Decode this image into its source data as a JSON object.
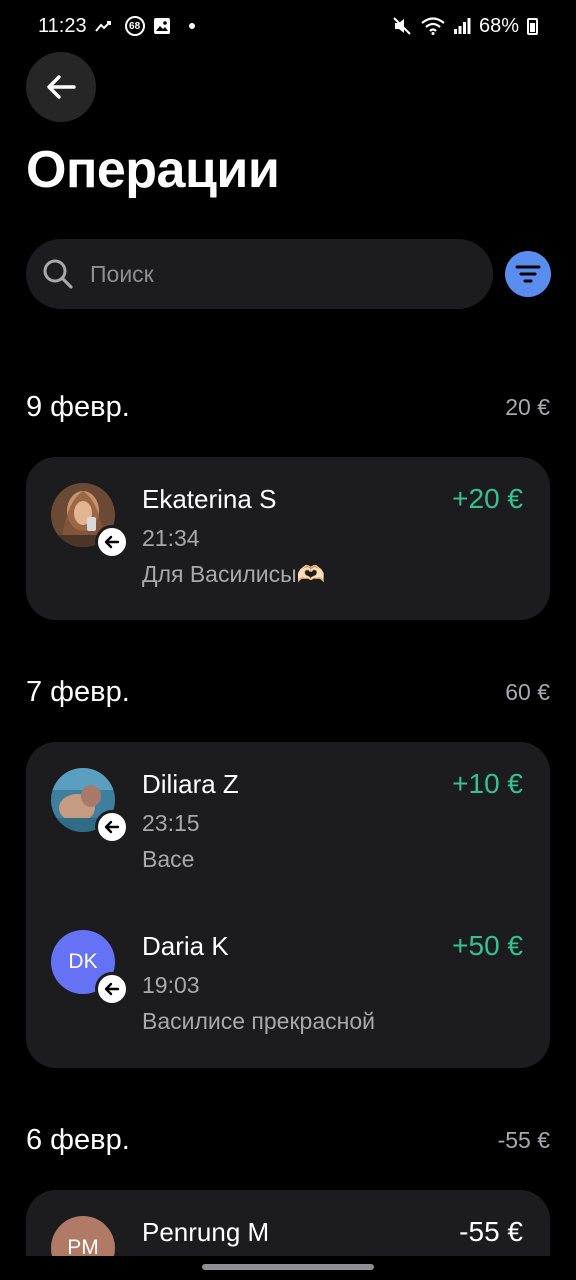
{
  "status_bar": {
    "time": "11:23",
    "notification_badge": "68",
    "battery": "68%"
  },
  "header": {
    "title": "Операции"
  },
  "search": {
    "placeholder": "Поиск"
  },
  "colors": {
    "background": "#000000",
    "card": "#1c1c1e",
    "accent": "#5b8def",
    "positive": "#34c28f",
    "secondary_text": "#a8a8ad"
  },
  "sections": [
    {
      "date": "9 февр.",
      "total": "20 €",
      "transactions": [
        {
          "name": "Ekaterina S",
          "time": "21:34",
          "note": "Для Василисы🫶🏻",
          "amount": "+20 €",
          "avatar": "photo",
          "direction": "incoming"
        }
      ]
    },
    {
      "date": "7 февр.",
      "total": "60 €",
      "transactions": [
        {
          "name": "Diliara Z",
          "time": "23:15",
          "note": "Васе",
          "amount": "+10 €",
          "avatar": "photo",
          "direction": "incoming"
        },
        {
          "name": "Daria K",
          "time": "19:03",
          "note": "Василисе прекрасной",
          "amount": "+50 €",
          "avatar_initials": "DK",
          "avatar_color": "#6672f5",
          "direction": "incoming"
        }
      ]
    },
    {
      "date": "6 февр.",
      "total": "-55 €",
      "transactions": [
        {
          "name": "Penrung M",
          "amount": "-55 €",
          "avatar_initials": "PM",
          "avatar_color": "#b07a66",
          "direction": "outgoing"
        }
      ]
    }
  ]
}
